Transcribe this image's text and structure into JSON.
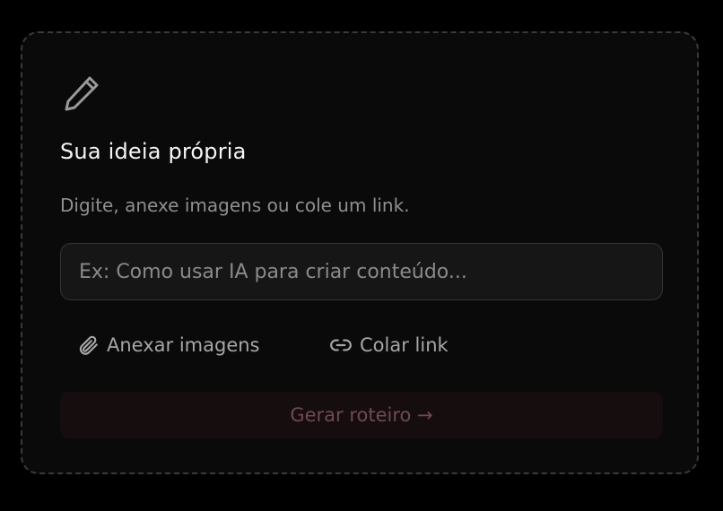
{
  "card": {
    "icon": "pencil-icon",
    "title": "Sua ideia própria",
    "subtitle": "Digite, anexe imagens ou cole um link.",
    "input": {
      "value": "",
      "placeholder": "Ex: Como usar IA para criar conteúdo..."
    },
    "actions": {
      "attach_label": "Anexar imagens",
      "attach_icon": "paperclip-icon",
      "link_label": "Colar link",
      "link_icon": "link-icon"
    },
    "submit_label": "Gerar roteiro →"
  },
  "colors": {
    "background": "#000000",
    "card": "#0a0a0a",
    "submit_bg": "#160d0f",
    "submit_text": "#6d4a52"
  }
}
